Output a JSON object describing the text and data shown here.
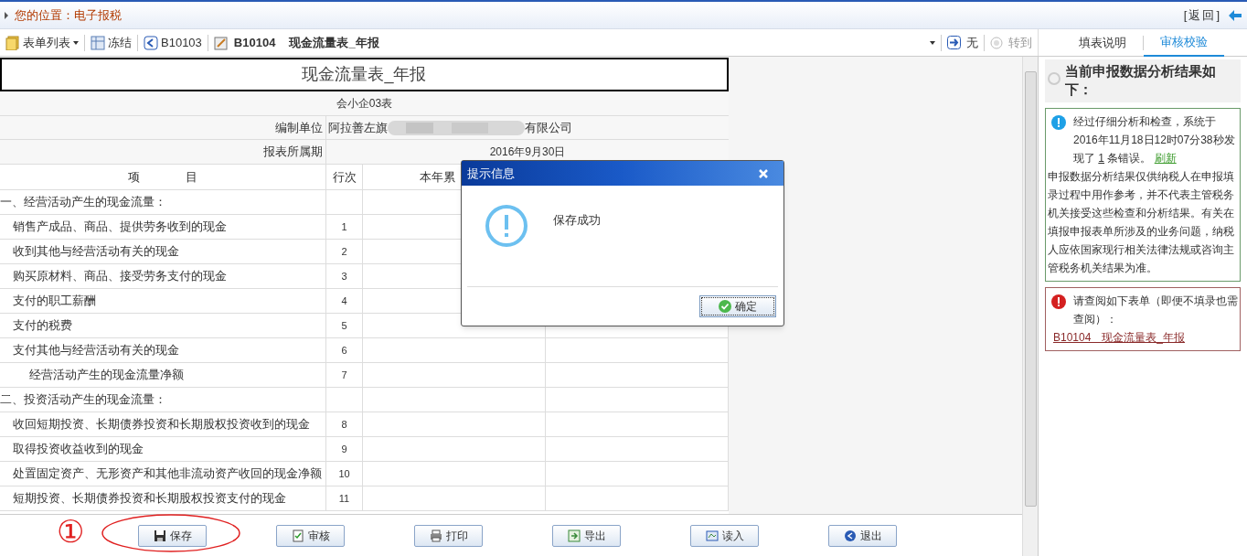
{
  "location": {
    "label": "您的位置：",
    "value": "电子报税"
  },
  "return_link": "[返回]",
  "toolbar": {
    "items": [
      {
        "kind": "menu",
        "label": "表单列表"
      },
      {
        "kind": "freeze",
        "label": "冻结"
      },
      {
        "kind": "prev",
        "label": "B10103"
      },
      {
        "kind": "current",
        "code": "B10104",
        "title": "现金流量表_年报"
      }
    ],
    "next": {
      "label": "无"
    },
    "goto": {
      "label": "转到",
      "disabled": true
    }
  },
  "panel_tabs": [
    {
      "label": "填表说明",
      "selected": false
    },
    {
      "label": "审核校验",
      "selected": true
    }
  ],
  "form": {
    "title": "现金流量表_年报",
    "subtitle": "会小企03表",
    "unit_label": "编制单位",
    "unit_prefix": "阿拉善左旗",
    "unit_suffix": "有限公司",
    "period_label": "报表所属期",
    "period_value": "2016年9月30日",
    "columns": [
      "项              目",
      "行次",
      "本年累"
    ],
    "rows": [
      {
        "kind": "section",
        "label": "一、经营活动产生的现金流量："
      },
      {
        "kind": "item",
        "label": "销售产成品、商品、提供劳务收到的现金",
        "line": "1"
      },
      {
        "kind": "item",
        "label": "收到其他与经营活动有关的现金",
        "line": "2"
      },
      {
        "kind": "item",
        "label": "购买原材料、商品、接受劳务支付的现金",
        "line": "3"
      },
      {
        "kind": "item",
        "label": "支付的职工薪酬",
        "line": "4"
      },
      {
        "kind": "item",
        "label": "支付的税费",
        "line": "5"
      },
      {
        "kind": "item",
        "label": "支付其他与经营活动有关的现金",
        "line": "6"
      },
      {
        "kind": "subtotal",
        "label": "经营活动产生的现金流量净额",
        "line": "7"
      },
      {
        "kind": "section",
        "label": "二、投资活动产生的现金流量："
      },
      {
        "kind": "item",
        "label": "收回短期投资、长期债券投资和长期股权投资收到的现金",
        "line": "8"
      },
      {
        "kind": "item",
        "label": "取得投资收益收到的现金",
        "line": "9"
      },
      {
        "kind": "item",
        "label": "处置固定资产、无形资产和其他非流动资产收回的现金净额",
        "line": "10"
      },
      {
        "kind": "item",
        "label": "短期投资、长期债券投资和长期股权投资支付的现金",
        "line": "11"
      }
    ]
  },
  "panel": {
    "heading": "当前申报数据分析结果如下：",
    "info": {
      "before": "经过仔细分析和检查，系统于2016年11月18日12时07分38秒发现了 ",
      "count": "1",
      "after": " 条错误。 ",
      "refresh": "刷新",
      "note": "申报数据分析结果仅供纳税人在申报填录过程中用作参考，并不代表主管税务机关接受这些检查和分析结果。有关在填报申报表单所涉及的业务问题，纳税人应依国家现行相关法律法规或咨询主管税务机关结果为准。"
    },
    "error": {
      "message": "请查阅如下表单（即便不填录也需查阅）：",
      "link": "B10104　现金流量表_年报"
    }
  },
  "buttons": [
    {
      "kind": "save",
      "label": "保存"
    },
    {
      "kind": "audit",
      "label": "审核"
    },
    {
      "kind": "print",
      "label": "打印"
    },
    {
      "kind": "export",
      "label": "导出"
    },
    {
      "kind": "import",
      "label": "读入"
    },
    {
      "kind": "exit",
      "label": "退出"
    }
  ],
  "dialog": {
    "title": "提示信息",
    "message": "保存成功",
    "ok": "确定"
  },
  "annotation": {
    "marker": "①"
  }
}
